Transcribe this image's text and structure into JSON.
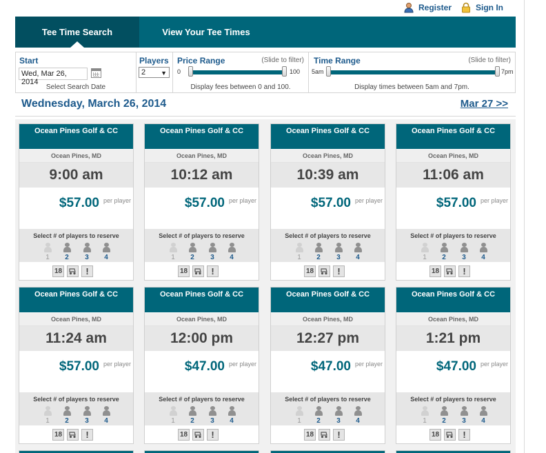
{
  "header": {
    "register_label": "Register",
    "signin_label": "Sign In",
    "register_icon": "user-icon",
    "signin_icon": "lock-icon"
  },
  "tabs": [
    {
      "label": "Tee Time Search",
      "active": true
    },
    {
      "label": "View Your Tee Times",
      "active": false
    }
  ],
  "filters": {
    "start": {
      "title": "Start",
      "value": "Wed, Mar 26, 2014",
      "note": "Select Search Date"
    },
    "players": {
      "title": "Players",
      "value": "2"
    },
    "price": {
      "title": "Price Range",
      "hint": "(Slide to filter)",
      "min_label": "0",
      "max_label": "100",
      "note": "Display fees between 0 and 100."
    },
    "time": {
      "title": "Time Range",
      "hint": "(Slide to filter)",
      "min_label": "5am",
      "max_label": "7pm",
      "note": "Display times between 5am and 7pm."
    }
  },
  "date_heading": "Wednesday, March 26, 2014",
  "next_link": "Mar 27 >>",
  "colors": {
    "brand": "#00667a",
    "brand_dark": "#024f60",
    "link": "#1d5a8c"
  },
  "cards": [
    {
      "course": "Ocean Pines Golf & CC",
      "location": "Ocean Pines, MD",
      "time": "9:00 am",
      "price": "$57.00",
      "per": "per player",
      "prompt": "Select # of players to reserve",
      "players": [
        "1",
        "2",
        "3",
        "4"
      ],
      "holes": "18"
    },
    {
      "course": "Ocean Pines Golf & CC",
      "location": "Ocean Pines, MD",
      "time": "10:12 am",
      "price": "$57.00",
      "per": "per player",
      "prompt": "Select # of players to reserve",
      "players": [
        "1",
        "2",
        "3",
        "4"
      ],
      "holes": "18"
    },
    {
      "course": "Ocean Pines Golf & CC",
      "location": "Ocean Pines, MD",
      "time": "10:39 am",
      "price": "$57.00",
      "per": "per player",
      "prompt": "Select # of players to reserve",
      "players": [
        "1",
        "2",
        "3",
        "4"
      ],
      "holes": "18"
    },
    {
      "course": "Ocean Pines Golf & CC",
      "location": "Ocean Pines, MD",
      "time": "11:06 am",
      "price": "$57.00",
      "per": "per player",
      "prompt": "Select # of players to reserve",
      "players": [
        "1",
        "2",
        "3",
        "4"
      ],
      "holes": "18"
    },
    {
      "course": "Ocean Pines Golf & CC",
      "location": "Ocean Pines, MD",
      "time": "11:24 am",
      "price": "$57.00",
      "per": "per player",
      "prompt": "Select # of players to reserve",
      "players": [
        "1",
        "2",
        "3",
        "4"
      ],
      "holes": "18"
    },
    {
      "course": "Ocean Pines Golf & CC",
      "location": "Ocean Pines, MD",
      "time": "12:00 pm",
      "price": "$47.00",
      "per": "per player",
      "prompt": "Select # of players to reserve",
      "players": [
        "1",
        "2",
        "3",
        "4"
      ],
      "holes": "18"
    },
    {
      "course": "Ocean Pines Golf & CC",
      "location": "Ocean Pines, MD",
      "time": "12:27 pm",
      "price": "$47.00",
      "per": "per player",
      "prompt": "Select # of players to reserve",
      "players": [
        "1",
        "2",
        "3",
        "4"
      ],
      "holes": "18"
    },
    {
      "course": "Ocean Pines Golf & CC",
      "location": "Ocean Pines, MD",
      "time": "1:21 pm",
      "price": "$47.00",
      "per": "per player",
      "prompt": "Select # of players to reserve",
      "players": [
        "1",
        "2",
        "3",
        "4"
      ],
      "holes": "18"
    }
  ]
}
